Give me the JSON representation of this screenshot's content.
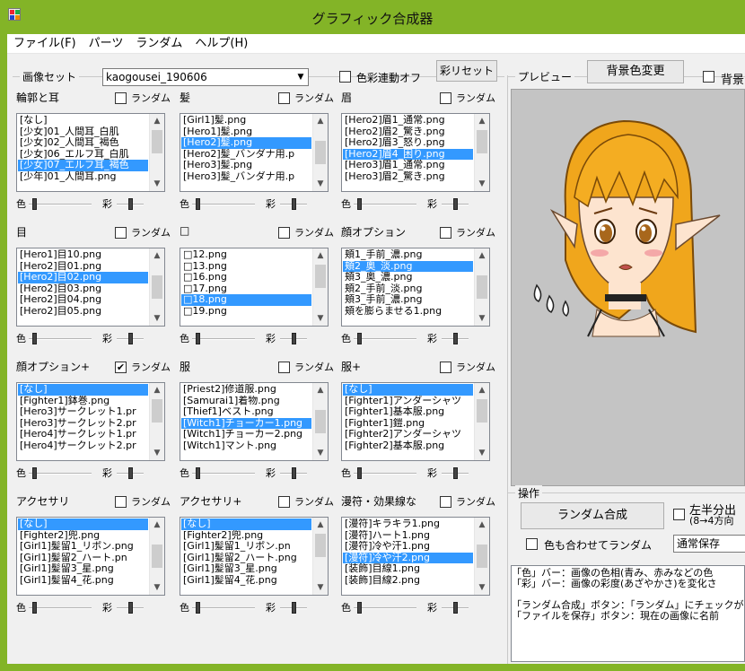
{
  "window": {
    "title": "グラフィック合成器",
    "accent": "#83b427"
  },
  "menu": [
    "ファイル(F)",
    "パーツ",
    "ランダム",
    "ヘルプ(H)"
  ],
  "imageset": {
    "group_label": "画像セット",
    "value": "kaogousei_190606",
    "color_link_label": "色彩連動オフ",
    "saturation_reset_button": "彩リセット"
  },
  "preview": {
    "group_label": "プレビュー",
    "bg_change_button": "背景色変更",
    "bg_checkbox_label": "背景"
  },
  "common": {
    "random_label": "ランダム",
    "color_label": "色",
    "saturation_label": "彩"
  },
  "parts": [
    {
      "title": "輪郭と耳",
      "random": false,
      "selected": 4,
      "items": [
        "[なし]",
        "[少女]01_人間耳_白肌",
        "[少女]02_人間耳_褐色",
        "[少女]06_エルフ耳_白肌",
        "[少女]07_エルフ耳_褐色",
        "[少年]01_人間耳.png"
      ]
    },
    {
      "title": "髪",
      "random": false,
      "selected": 2,
      "items": [
        "[Girl1]髪.png",
        "[Hero1]髪.png",
        "[Hero2]髪.png",
        "[Hero2]髪_バンダナ用.p",
        "[Hero3]髪.png",
        "[Hero3]髪_バンダナ用.p"
      ]
    },
    {
      "title": "眉",
      "random": false,
      "selected": 3,
      "items": [
        "[Hero2]眉1_通常.png",
        "[Hero2]眉2_驚き.png",
        "[Hero2]眉3_怒り.png",
        "[Hero2]眉4_困り.png",
        "[Hero3]眉1_通常.png",
        "[Hero3]眉2_驚き.png"
      ]
    },
    {
      "title": "目",
      "random": false,
      "selected": 2,
      "items": [
        "[Hero1]目10.png",
        "[Hero2]目01.png",
        "[Hero2]目02.png",
        "[Hero2]目03.png",
        "[Hero2]目04.png",
        "[Hero2]目05.png"
      ]
    },
    {
      "title": "□",
      "random": false,
      "selected": 4,
      "items": [
        "□12.png",
        "□13.png",
        "□16.png",
        "□17.png",
        "□18.png",
        "□19.png"
      ]
    },
    {
      "title": "顔オプション",
      "random": false,
      "selected": 1,
      "items": [
        "頬1_手前_濃.png",
        "頬2_奥_淡.png",
        "頬3_奥_濃.png",
        "頬2_手前_淡.png",
        "頬3_手前_濃.png",
        "頬を膨らませる1.png"
      ]
    },
    {
      "title": "顔オプション+",
      "random": true,
      "selected": 0,
      "items": [
        "[なし]",
        "[Fighter1]鉢巻.png",
        "[Hero3]サークレット1.pr",
        "[Hero3]サークレット2.pr",
        "[Hero4]サークレット1.pr",
        "[Hero4]サークレット2.pr"
      ]
    },
    {
      "title": "服",
      "random": false,
      "selected": 3,
      "items": [
        "[Priest2]修道服.png",
        "[Samurai1]着物.png",
        "[Thief1]ベスト.png",
        "[Witch1]チョーカー1.png",
        "[Witch1]チョーカー2.png",
        "[Witch1]マント.png"
      ]
    },
    {
      "title": "服+",
      "random": false,
      "selected": 0,
      "items": [
        "[なし]",
        "[Fighter1]アンダーシャツ",
        "[Fighter1]基本服.png",
        "[Fighter1]鎧.png",
        "[Fighter2]アンダーシャツ",
        "[Fighter2]基本服.png"
      ]
    },
    {
      "title": "アクセサリ",
      "random": false,
      "selected": 0,
      "items": [
        "[なし]",
        "[Fighter2]兜.png",
        "[Girl1]髪留1_リボン.png",
        "[Girl1]髪留2_ハート.pn",
        "[Girl1]髪留3_星.png",
        "[Girl1]髪留4_花.png"
      ]
    },
    {
      "title": "アクセサリ+",
      "random": false,
      "selected": 0,
      "items": [
        "[なし]",
        "[Fighter2]兜.png",
        "[Girl1]髪留1_リボン.pn",
        "[Girl1]髪留2_ハート.png",
        "[Girl1]髪留3_星.png",
        "[Girl1]髪留4_花.png"
      ]
    },
    {
      "title": "漫符・効果線な",
      "random": false,
      "selected": 3,
      "items": [
        "[漫符]キラキラ1.png",
        "[漫符]ハート1.png",
        "[漫符]冷や汗1.png",
        "[漫符]冷や汗2.png",
        "[装飾]目線1.png",
        "[装飾]目線2.png"
      ]
    }
  ],
  "operations": {
    "group_label": "操作",
    "random_compose_button": "ランダム合成",
    "color_random_label": "色も合わせてランダム",
    "split_label_1": "左半分出",
    "split_label_2": "(8→4方向",
    "save_mode_value": "通常保存"
  },
  "help_text": [
    "「色」バー：画像の色相(青み、赤みなどの色",
    "「彩」バー：画像の彩度(あざやかさ)を変化さ",
    "",
    "「ランダム合成」ボタン：「ランダム」にチェックが",
    "「ファイルを保存」ボタン：現在の画像に名前"
  ]
}
